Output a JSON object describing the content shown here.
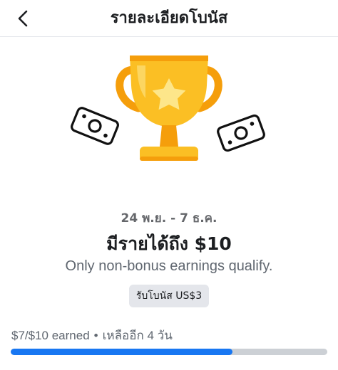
{
  "header": {
    "title": "รายละเอียดโบนัส",
    "back_icon": "chevron-left-icon"
  },
  "hero": {
    "icons": [
      "trophy-icon",
      "money-icon",
      "money-icon"
    ],
    "colors": {
      "trophy_gold": "#fbbf24",
      "trophy_shade": "#f59e0b",
      "star": "#fde68a"
    }
  },
  "details": {
    "date_range": "24 พ.ย. - 7 ธ.ค.",
    "headline": "มีรายได้ถึง $10",
    "subtext": "Only non-bonus earnings qualify.",
    "badge": "รับโบนัส US$3"
  },
  "progress": {
    "earned_text": "$7/$10 earned",
    "separator": "•",
    "remaining_text": "เหลืออีก 4 วัน",
    "fraction": 0.7,
    "color": "#1877f2"
  }
}
